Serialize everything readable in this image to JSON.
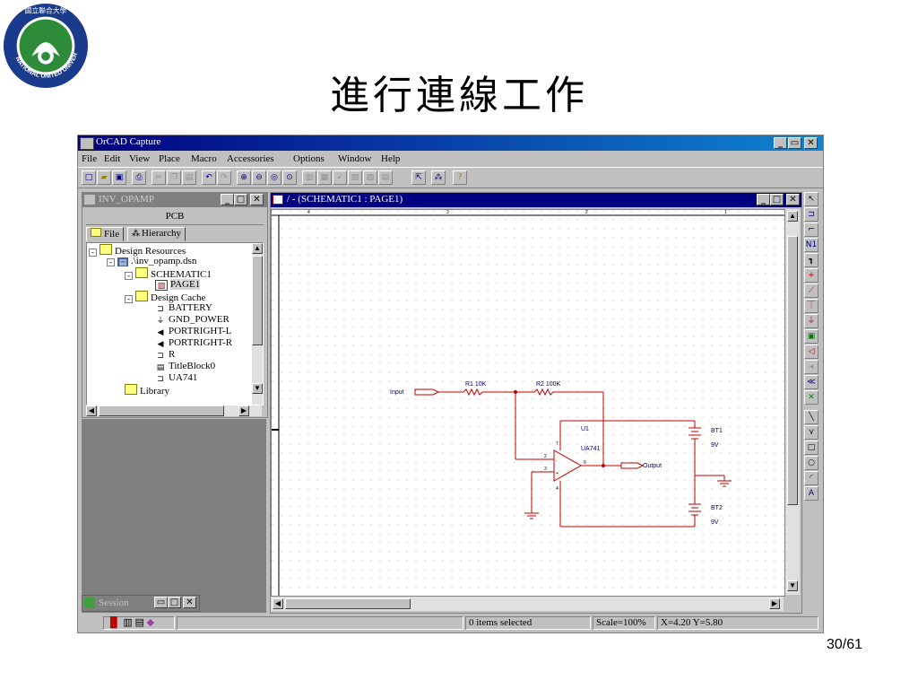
{
  "slide": {
    "title": "進行連線工作",
    "page_number": "30/61"
  },
  "logo": {
    "text": "NATIONAL UNITED UNIVERSITY",
    "seal": "國立聯合大學"
  },
  "app": {
    "title": "OrCAD Capture",
    "menu": [
      "File",
      "Edit",
      "View",
      "Place",
      "Macro",
      "Accessories",
      "Options",
      "Window",
      "Help"
    ],
    "window_buttons": [
      "_",
      "▭",
      "✕"
    ]
  },
  "project": {
    "title": "INV_OPAMP",
    "pcb_label": "PCB",
    "tabs": [
      "File",
      "Hierarchy"
    ],
    "tree": [
      {
        "label": "Design Resources"
      },
      {
        "label": ".\\inv_opamp.dsn"
      },
      {
        "label": "SCHEMATIC1"
      },
      {
        "label": "PAGE1"
      },
      {
        "label": "Design Cache"
      },
      {
        "label": "BATTERY"
      },
      {
        "label": "GND_POWER"
      },
      {
        "label": "PORTRIGHT-L"
      },
      {
        "label": "PORTRIGHT-R"
      },
      {
        "label": "R"
      },
      {
        "label": "TitleBlock0"
      },
      {
        "label": "UA741"
      },
      {
        "label": "Library"
      }
    ],
    "session_title": "Session"
  },
  "schematic": {
    "title": "/ - (SCHEMATIC1 : PAGE1)",
    "ruler": [
      "4",
      "3",
      "2",
      "1"
    ],
    "labels": {
      "input": "Input",
      "r1": "R1  10K",
      "r2": "R2   100K",
      "u1": "U1",
      "ua741": "UA741",
      "output": "Output",
      "bt1": "BT1",
      "bt1_v": "9V",
      "bt2": "BT2",
      "bt2_v": "9V",
      "pin2": "2",
      "pin3": "3",
      "pin6": "6",
      "pin4": "4",
      "pin7": "7",
      "plus": "+",
      "minus": "-"
    }
  },
  "status": {
    "selected": "0 items selected",
    "scale": "Scale=100%",
    "coords": "X=4.20  Y=5.80"
  }
}
